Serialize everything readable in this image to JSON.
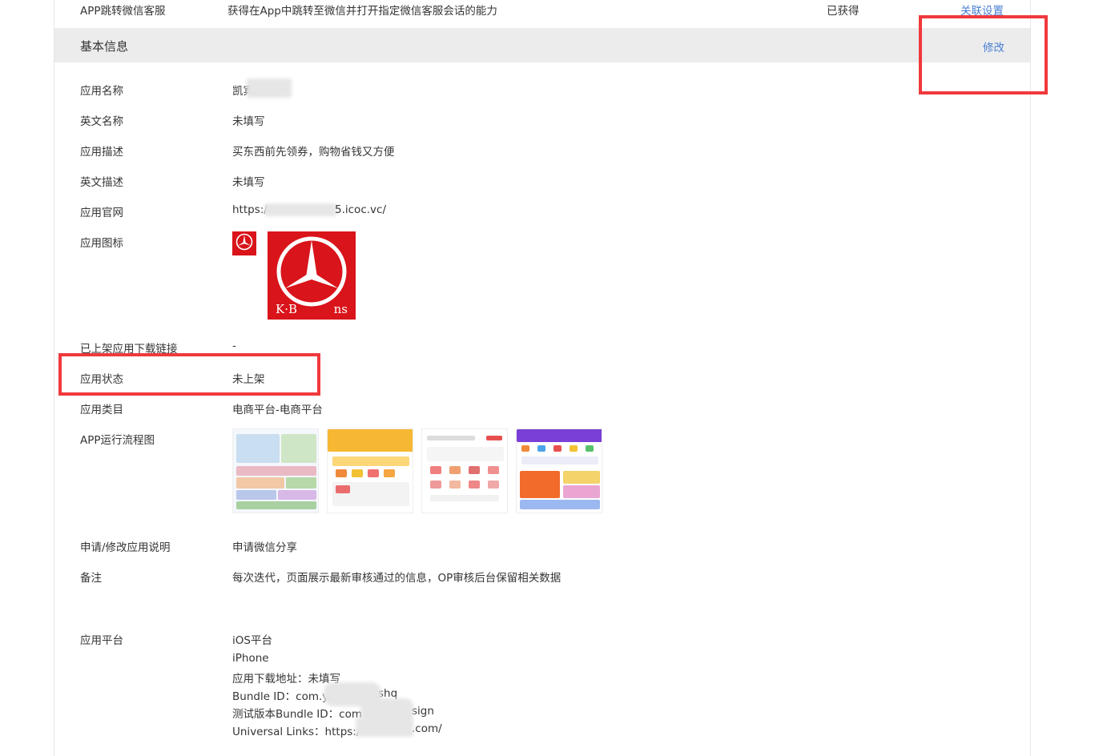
{
  "top_row": {
    "name": "APP跳转微信客服",
    "desc": "获得在App中跳转至微信并打开指定微信客服会话的能力",
    "status": "已获得",
    "action": "关联设置"
  },
  "section": {
    "title": "基本信息",
    "edit_label": "修改"
  },
  "fields": {
    "app_name": {
      "label": "应用名称",
      "value": "凯宾"
    },
    "en_name": {
      "label": "英文名称",
      "value": "未填写"
    },
    "app_desc": {
      "label": "应用描述",
      "value": "买东西前先领券，购物省钱又方便"
    },
    "en_desc": {
      "label": "英文描述",
      "value": "未填写"
    },
    "website": {
      "label": "应用官网",
      "value_prefix": "https:/",
      "value_suffix": "5.icoc.vc/"
    },
    "icon": {
      "label": "应用图标",
      "brand_left": "K·B",
      "brand_right": "ns"
    },
    "download_link": {
      "label": "已上架应用下载链接",
      "value": "-"
    },
    "status": {
      "label": "应用状态",
      "value": "未上架"
    },
    "category": {
      "label": "应用类目",
      "value": "电商平台-电商平台"
    },
    "flow": {
      "label": "APP运行流程图"
    },
    "apply_note": {
      "label": "申请/修改应用说明",
      "value": "申请微信分享"
    },
    "remark": {
      "label": "备注",
      "value": "每次迭代，页面展示最新审核通过的信息，OP审核后台保留相关数据"
    },
    "platform": {
      "label": "应用平台",
      "lines": {
        "platform": "iOS平台",
        "device": "iPhone",
        "download": "应用下载地址：未填写",
        "bundle": "Bundle ID：com.y",
        "bundle_tail": "shq",
        "test_bundle": "测试版本Bundle ID：com",
        "test_bundle_tail": "sign",
        "universal": "Universal Links：https:/",
        "universal_tail": ".com/"
      }
    }
  },
  "colors": {
    "link": "#4a7fd3",
    "highlight": "#f0393c",
    "icon_bg": "#d9141a",
    "section_bg": "#ececec"
  }
}
